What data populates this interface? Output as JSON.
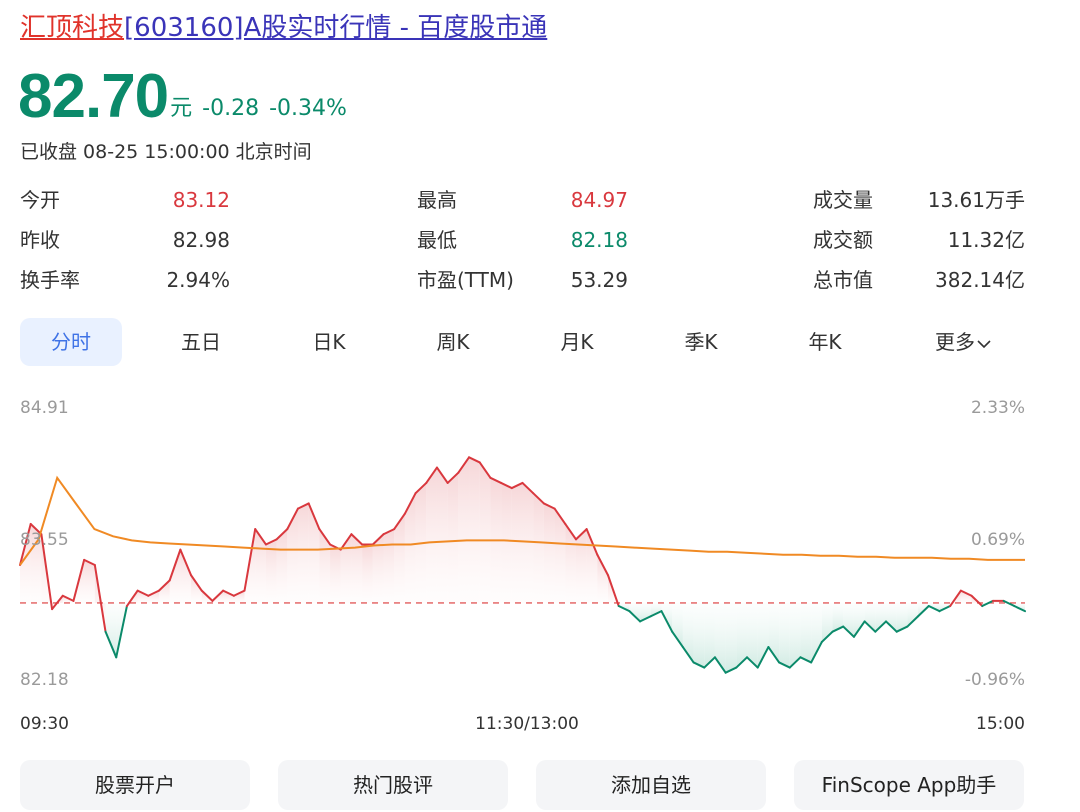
{
  "header": {
    "name": "汇顶科技",
    "title_rest": "[603160]A股实时行情 - 百度股市通"
  },
  "quote": {
    "price": "82.70",
    "unit": "元",
    "change": "-0.28",
    "change_pct": "-0.34%",
    "status": "已收盘 08-25 15:00:00 北京时间"
  },
  "stats": [
    [
      {
        "label": "今开",
        "value": "83.12",
        "tone": "up"
      },
      {
        "label": "最高",
        "value": "84.97",
        "tone": "up"
      },
      {
        "label": "成交量",
        "value": "13.61万手",
        "tone": "flat"
      }
    ],
    [
      {
        "label": "昨收",
        "value": "82.98",
        "tone": "flat"
      },
      {
        "label": "最低",
        "value": "82.18",
        "tone": "down"
      },
      {
        "label": "成交额",
        "value": "11.32亿",
        "tone": "flat"
      }
    ],
    [
      {
        "label": "换手率",
        "value": "2.94%",
        "tone": "flat"
      },
      {
        "label": "市盈(TTM)",
        "value": "53.29",
        "tone": "flat"
      },
      {
        "label": "总市值",
        "value": "382.14亿",
        "tone": "flat"
      }
    ]
  ],
  "tabs": [
    "分时",
    "五日",
    "日K",
    "周K",
    "月K",
    "季K",
    "年K",
    "更多"
  ],
  "active_tab": "分时",
  "chart_data": {
    "type": "line",
    "title": "",
    "price_axis": [
      "84.91",
      "83.55",
      "82.18"
    ],
    "pct_axis": [
      "2.33%",
      "0.69%",
      "-0.96%"
    ],
    "x_labels": [
      "09:30",
      "11:30/13:00",
      "15:00"
    ],
    "prev_close": 82.98,
    "ylim": [
      82.18,
      84.91
    ],
    "colors": {
      "up": "#d9383e",
      "down": "#0b8a6a",
      "avg": "#f08a24",
      "ref": "#e25c5c"
    },
    "series": [
      {
        "values": [
          83.35,
          83.75,
          83.65,
          82.92,
          83.05,
          83.0,
          83.4,
          83.35,
          82.7,
          82.45,
          82.95,
          83.1,
          83.05,
          83.1,
          83.2,
          83.5,
          83.25,
          83.1,
          83.0,
          83.1,
          83.05,
          83.1,
          83.7,
          83.55,
          83.6,
          83.7,
          83.9,
          83.95,
          83.7,
          83.55,
          83.5,
          83.65,
          83.55,
          83.55,
          83.65,
          83.7,
          83.85,
          84.05,
          84.15,
          84.3,
          84.15,
          84.25,
          84.4,
          84.35,
          84.2,
          84.15,
          84.1,
          84.15,
          84.05,
          83.95,
          83.9,
          83.75,
          83.6,
          83.7,
          83.45,
          83.25,
          82.95,
          82.9,
          82.8,
          82.85,
          82.9,
          82.7,
          82.55,
          82.4,
          82.35,
          82.45,
          82.3,
          82.35,
          82.45,
          82.35,
          82.55,
          82.4,
          82.35,
          82.45,
          82.4,
          82.6,
          82.7,
          82.75,
          82.65,
          82.8,
          82.7,
          82.8,
          82.7,
          82.75,
          82.85,
          82.95,
          82.9,
          82.95,
          83.1,
          83.05,
          82.95,
          83.0,
          83.0,
          82.95,
          82.9
        ]
      },
      {
        "values": [
          83.35,
          83.6,
          84.2,
          83.95,
          83.7,
          83.63,
          83.59,
          83.57,
          83.56,
          83.55,
          83.54,
          83.53,
          83.52,
          83.51,
          83.5,
          83.5,
          83.5,
          83.51,
          83.52,
          83.54,
          83.55,
          83.55,
          83.57,
          83.58,
          83.59,
          83.59,
          83.59,
          83.58,
          83.57,
          83.56,
          83.55,
          83.54,
          83.53,
          83.52,
          83.51,
          83.5,
          83.49,
          83.48,
          83.48,
          83.47,
          83.46,
          83.45,
          83.45,
          83.44,
          83.44,
          83.43,
          83.43,
          83.42,
          83.42,
          83.42,
          83.41,
          83.41,
          83.4,
          83.4,
          83.4
        ]
      }
    ]
  },
  "buttons": [
    "股票开户",
    "热门股评",
    "添加自选",
    "FinScope App助手"
  ]
}
